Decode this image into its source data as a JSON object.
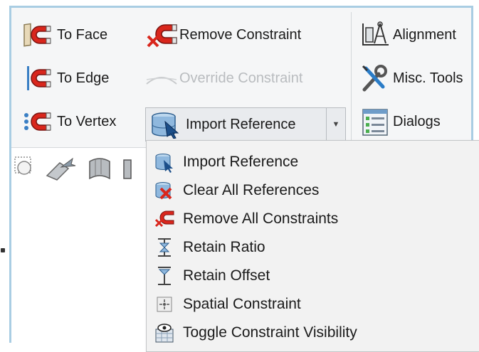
{
  "ribbon": {
    "to_face": "To Face",
    "to_edge": "To Edge",
    "to_vertex": "To Vertex",
    "remove_constraint": "Remove Constraint",
    "override_constraint": "Override Constraint",
    "import_reference": "Import Reference",
    "alignment": "Alignment",
    "misc_tools": "Misc. Tools",
    "dialogs": "Dialogs"
  },
  "menu": {
    "items": [
      {
        "label": "Import Reference",
        "icon": "import-reference-icon"
      },
      {
        "label": "Clear All References",
        "icon": "clear-references-icon"
      },
      {
        "label": "Remove All Constraints",
        "icon": "remove-constraints-icon"
      },
      {
        "label": "Retain Ratio",
        "icon": "retain-ratio-icon"
      },
      {
        "label": "Retain Offset",
        "icon": "retain-offset-icon"
      },
      {
        "label": "Spatial Constraint",
        "icon": "spatial-constraint-icon"
      },
      {
        "label": "Toggle Constraint Visibility",
        "icon": "toggle-visibility-icon"
      }
    ]
  },
  "colors": {
    "frame_border": "#a9cde3",
    "magnet_red": "#d9261c",
    "disabled_text": "#b9bcbf"
  }
}
